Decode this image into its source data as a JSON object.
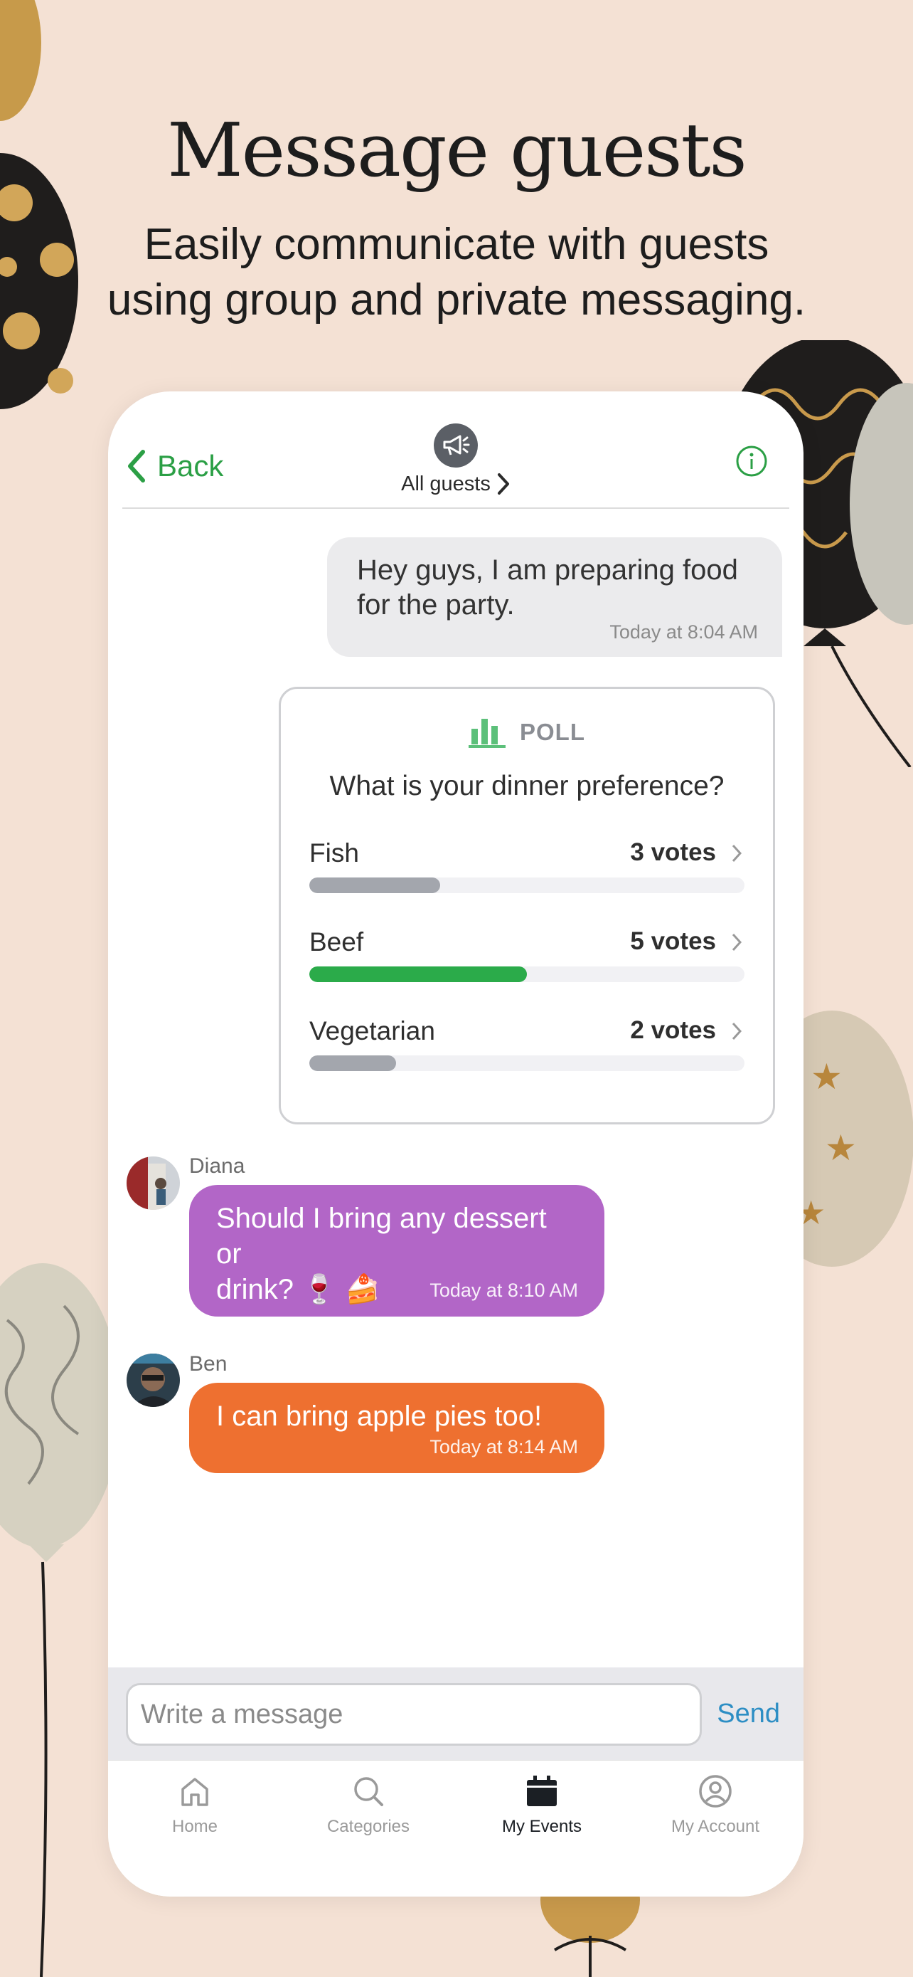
{
  "headline": "Message guests",
  "subheadline": {
    "line1": "Easily communicate with guests",
    "line2": "using group and private messaging."
  },
  "nav": {
    "back_label": "Back",
    "title": "All guests",
    "icons": [
      "chevron-left-icon",
      "megaphone-icon",
      "chevron-right-icon",
      "info-icon"
    ]
  },
  "messages": {
    "outgoing": {
      "line1": "Hey guys, I am preparing food",
      "line2": "for the party.",
      "time": "Today at 8:04 AM"
    },
    "diana": {
      "sender": "Diana",
      "line1": "Should I bring any dessert or",
      "line2": "drink? 🍷 🍰",
      "time": "Today at 8:10 AM",
      "color": "#b266c7"
    },
    "ben": {
      "sender": "Ben",
      "text": "I can bring apple pies too!",
      "time": "Today at 8:14 AM",
      "color": "#ee7030"
    }
  },
  "poll": {
    "header": "POLL",
    "question": "What is your dinner preference?",
    "options": [
      {
        "label": "Fish",
        "votes": "3 votes",
        "share": 0.3,
        "color": "#a3a6ad"
      },
      {
        "label": "Beef",
        "votes": "5 votes",
        "share": 0.5,
        "color": "#2bab4a"
      },
      {
        "label": "Vegetarian",
        "votes": "2 votes",
        "share": 0.2,
        "color": "#a3a6ad"
      }
    ]
  },
  "composer": {
    "placeholder": "Write a message",
    "send_label": "Send"
  },
  "tabs": [
    {
      "label": "Home",
      "icon": "home-icon"
    },
    {
      "label": "Categories",
      "icon": "search-icon"
    },
    {
      "label": "My Events",
      "icon": "calendar-icon",
      "active": true
    },
    {
      "label": "My Account",
      "icon": "account-icon"
    }
  ],
  "colors": {
    "background": "#f4e1d4",
    "accent_green": "#2b9f45",
    "send_blue": "#2d8ec4"
  }
}
